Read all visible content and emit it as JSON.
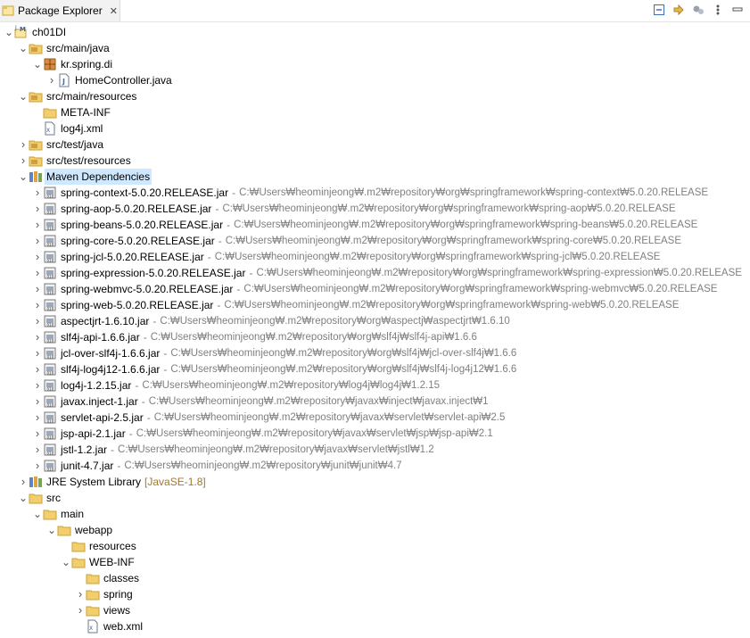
{
  "tab": {
    "title": "Package Explorer",
    "close": "✕"
  },
  "toolbar": [
    {
      "icon": "collapse-all-icon"
    },
    {
      "icon": "link-editor-icon"
    },
    {
      "icon": "filters-icon"
    },
    {
      "icon": "view-menu-icon"
    },
    {
      "icon": "minimize-icon"
    }
  ],
  "colors": {
    "selection": "#cde8ff",
    "path": "#808080",
    "jre_suffix": "#a07830"
  },
  "tree": [
    {
      "level": 0,
      "expand": "open",
      "icon": "maven-project-icon",
      "label": "ch01DI"
    },
    {
      "level": 1,
      "expand": "open",
      "icon": "source-folder-icon",
      "label": "src/main/java"
    },
    {
      "level": 2,
      "expand": "open",
      "icon": "package-icon",
      "label": "kr.spring.di"
    },
    {
      "level": 3,
      "expand": "closed",
      "icon": "java-file-icon",
      "label": "HomeController.java"
    },
    {
      "level": 1,
      "expand": "open",
      "icon": "source-folder-icon",
      "label": "src/main/resources"
    },
    {
      "level": 2,
      "expand": "none",
      "icon": "folder-icon",
      "label": "META-INF"
    },
    {
      "level": 2,
      "expand": "none",
      "icon": "xml-file-icon",
      "label": "log4j.xml"
    },
    {
      "level": 1,
      "expand": "closed",
      "icon": "source-folder-icon",
      "label": "src/test/java"
    },
    {
      "level": 1,
      "expand": "closed",
      "icon": "source-folder-icon",
      "label": "src/test/resources"
    },
    {
      "level": 1,
      "expand": "open",
      "icon": "library-icon",
      "label": "Maven Dependencies",
      "selected": true
    },
    {
      "level": 2,
      "expand": "closed",
      "icon": "jar-icon",
      "label": "spring-context-5.0.20.RELEASE.jar",
      "path": "C:₩Users₩heominjeong₩.m2₩repository₩org₩springframework₩spring-context₩5.0.20.RELEASE"
    },
    {
      "level": 2,
      "expand": "closed",
      "icon": "jar-icon",
      "label": "spring-aop-5.0.20.RELEASE.jar",
      "path": "C:₩Users₩heominjeong₩.m2₩repository₩org₩springframework₩spring-aop₩5.0.20.RELEASE"
    },
    {
      "level": 2,
      "expand": "closed",
      "icon": "jar-icon",
      "label": "spring-beans-5.0.20.RELEASE.jar",
      "path": "C:₩Users₩heominjeong₩.m2₩repository₩org₩springframework₩spring-beans₩5.0.20.RELEASE"
    },
    {
      "level": 2,
      "expand": "closed",
      "icon": "jar-icon",
      "label": "spring-core-5.0.20.RELEASE.jar",
      "path": "C:₩Users₩heominjeong₩.m2₩repository₩org₩springframework₩spring-core₩5.0.20.RELEASE"
    },
    {
      "level": 2,
      "expand": "closed",
      "icon": "jar-icon",
      "label": "spring-jcl-5.0.20.RELEASE.jar",
      "path": "C:₩Users₩heominjeong₩.m2₩repository₩org₩springframework₩spring-jcl₩5.0.20.RELEASE"
    },
    {
      "level": 2,
      "expand": "closed",
      "icon": "jar-icon",
      "label": "spring-expression-5.0.20.RELEASE.jar",
      "path": "C:₩Users₩heominjeong₩.m2₩repository₩org₩springframework₩spring-expression₩5.0.20.RELEASE"
    },
    {
      "level": 2,
      "expand": "closed",
      "icon": "jar-icon",
      "label": "spring-webmvc-5.0.20.RELEASE.jar",
      "path": "C:₩Users₩heominjeong₩.m2₩repository₩org₩springframework₩spring-webmvc₩5.0.20.RELEASE"
    },
    {
      "level": 2,
      "expand": "closed",
      "icon": "jar-icon",
      "label": "spring-web-5.0.20.RELEASE.jar",
      "path": "C:₩Users₩heominjeong₩.m2₩repository₩org₩springframework₩spring-web₩5.0.20.RELEASE"
    },
    {
      "level": 2,
      "expand": "closed",
      "icon": "jar-icon",
      "label": "aspectjrt-1.6.10.jar",
      "path": "C:₩Users₩heominjeong₩.m2₩repository₩org₩aspectj₩aspectjrt₩1.6.10"
    },
    {
      "level": 2,
      "expand": "closed",
      "icon": "jar-icon",
      "label": "slf4j-api-1.6.6.jar",
      "path": "C:₩Users₩heominjeong₩.m2₩repository₩org₩slf4j₩slf4j-api₩1.6.6"
    },
    {
      "level": 2,
      "expand": "closed",
      "icon": "jar-icon",
      "label": "jcl-over-slf4j-1.6.6.jar",
      "path": "C:₩Users₩heominjeong₩.m2₩repository₩org₩slf4j₩jcl-over-slf4j₩1.6.6"
    },
    {
      "level": 2,
      "expand": "closed",
      "icon": "jar-icon",
      "label": "slf4j-log4j12-1.6.6.jar",
      "path": "C:₩Users₩heominjeong₩.m2₩repository₩org₩slf4j₩slf4j-log4j12₩1.6.6"
    },
    {
      "level": 2,
      "expand": "closed",
      "icon": "jar-icon",
      "label": "log4j-1.2.15.jar",
      "path": "C:₩Users₩heominjeong₩.m2₩repository₩log4j₩log4j₩1.2.15"
    },
    {
      "level": 2,
      "expand": "closed",
      "icon": "jar-icon",
      "label": "javax.inject-1.jar",
      "path": "C:₩Users₩heominjeong₩.m2₩repository₩javax₩inject₩javax.inject₩1"
    },
    {
      "level": 2,
      "expand": "closed",
      "icon": "jar-icon",
      "label": "servlet-api-2.5.jar",
      "path": "C:₩Users₩heominjeong₩.m2₩repository₩javax₩servlet₩servlet-api₩2.5"
    },
    {
      "level": 2,
      "expand": "closed",
      "icon": "jar-icon",
      "label": "jsp-api-2.1.jar",
      "path": "C:₩Users₩heominjeong₩.m2₩repository₩javax₩servlet₩jsp₩jsp-api₩2.1"
    },
    {
      "level": 2,
      "expand": "closed",
      "icon": "jar-icon",
      "label": "jstl-1.2.jar",
      "path": "C:₩Users₩heominjeong₩.m2₩repository₩javax₩servlet₩jstl₩1.2"
    },
    {
      "level": 2,
      "expand": "closed",
      "icon": "jar-icon",
      "label": "junit-4.7.jar",
      "path": "C:₩Users₩heominjeong₩.m2₩repository₩junit₩junit₩4.7"
    },
    {
      "level": 1,
      "expand": "closed",
      "icon": "library-icon",
      "label": "JRE System Library",
      "suffix": "[JavaSE-1.8]"
    },
    {
      "level": 1,
      "expand": "open",
      "icon": "folder-icon",
      "label": "src"
    },
    {
      "level": 2,
      "expand": "open",
      "icon": "folder-icon",
      "label": "main"
    },
    {
      "level": 3,
      "expand": "open",
      "icon": "folder-icon",
      "label": "webapp"
    },
    {
      "level": 4,
      "expand": "none",
      "icon": "folder-icon",
      "label": "resources"
    },
    {
      "level": 4,
      "expand": "open",
      "icon": "folder-icon",
      "label": "WEB-INF"
    },
    {
      "level": 5,
      "expand": "none",
      "icon": "folder-icon",
      "label": "classes"
    },
    {
      "level": 5,
      "expand": "closed",
      "icon": "folder-icon",
      "label": "spring"
    },
    {
      "level": 5,
      "expand": "closed",
      "icon": "folder-icon",
      "label": "views"
    },
    {
      "level": 5,
      "expand": "none",
      "icon": "xml-file-icon",
      "label": "web.xml"
    }
  ]
}
